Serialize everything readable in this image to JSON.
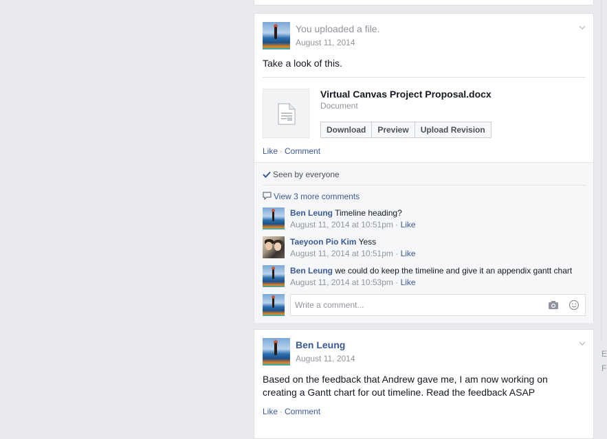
{
  "feed": {
    "post1": {
      "headline": "You uploaded a file.",
      "date": "August 11, 2014",
      "text": "Take a look of this.",
      "attachment": {
        "name": "Virtual Canvas Project Proposal.docx",
        "type": "Document",
        "buttons": {
          "download": "Download",
          "preview": "Preview",
          "upload_revision": "Upload Revision"
        }
      },
      "actions": {
        "like": "Like",
        "separator": "·",
        "comment": "Comment"
      },
      "seen": "Seen by everyone",
      "view_more": "View 3 more comments",
      "comments": [
        {
          "author": "Ben Leung",
          "text": "Timeline heading?",
          "time": "August 11, 2014 at 10:51pm",
          "like": "Like"
        },
        {
          "author": "Taeyoon Pio Kim",
          "text": "Yess",
          "time": "August 11, 2014 at 10:51pm",
          "like": "Like"
        },
        {
          "author": "Ben Leung",
          "text": "we could do keep the timeline and give it an appendix gantt chart",
          "time": "August 11, 2014 at 10:53pm",
          "like": "Like"
        }
      ],
      "comment_placeholder": "Write a comment..."
    },
    "post2": {
      "author": "Ben Leung",
      "date": "August 11, 2014",
      "text_line1": "Based on the feedback that Andrew gave me, I am now working on",
      "text_line2": "creating a Gantt chart for out timeline. Read the feedback ASAP",
      "actions": {
        "like": "Like",
        "separator": "·",
        "comment": "Comment"
      }
    }
  },
  "right_edge": {
    "letter1": "E",
    "letter2": "F"
  },
  "icons": [
    "chevron-down-icon",
    "document-icon",
    "checkmark-icon",
    "comment-bubble-icon",
    "camera-icon",
    "smiley-icon"
  ],
  "colors": {
    "link": "#3b5998",
    "background": "#e9eaed",
    "muted": "#90949c"
  }
}
